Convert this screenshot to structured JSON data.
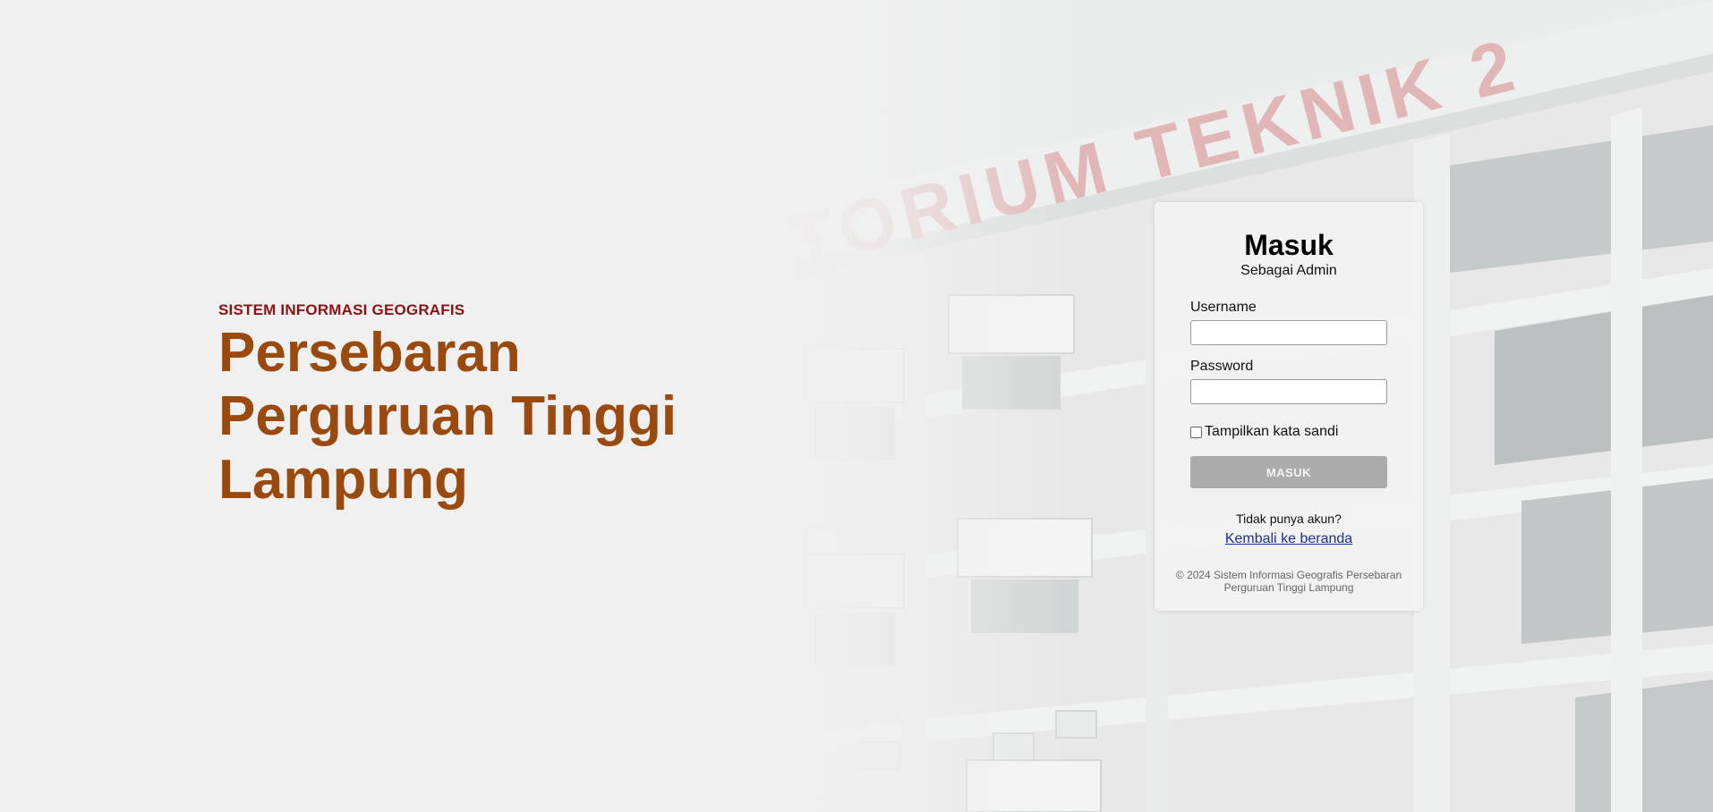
{
  "hero": {
    "eyebrow": "SISTEM INFORMASI GEOGRAFIS",
    "title_lines": [
      "Persebaran",
      "Perguruan Tinggi",
      "Lampung"
    ]
  },
  "background": {
    "sign_text": "TORIUM TEKNIK 2"
  },
  "login": {
    "title": "Masuk",
    "subtitle": "Sebagai Admin",
    "username_label": "Username",
    "username_value": "",
    "password_label": "Password",
    "password_value": "",
    "show_password_label": "Tampilkan kata sandi",
    "show_password_checked": false,
    "submit_label": "MASUK",
    "no_account_text": "Tidak punya akun?",
    "back_link_label": "Kembali ke beranda",
    "footer_line1": "© 2024 Sistem Informasi Geografis Persebaran",
    "footer_line2": "Perguruan Tinggi Lampung"
  },
  "colors": {
    "page_bg": "#f0f0f0",
    "eyebrow": "#8a1414",
    "title": "#9a4a0e",
    "button_bg": "#acacac",
    "link": "#1f2f8f",
    "sign_letters": "#d98a8a"
  }
}
